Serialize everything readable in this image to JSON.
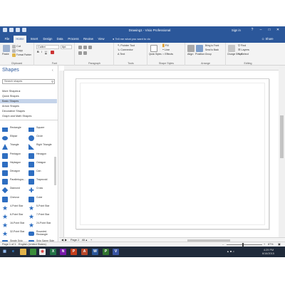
{
  "window": {
    "title": "Drawing1 - Visio Professional",
    "sign_in": "Sign in",
    "controls": [
      "?",
      "–",
      "□",
      "✕"
    ]
  },
  "tabs": [
    {
      "label": "File"
    },
    {
      "label": "Home",
      "active": true
    },
    {
      "label": "Insert"
    },
    {
      "label": "Design"
    },
    {
      "label": "Data"
    },
    {
      "label": "Process"
    },
    {
      "label": "Review"
    },
    {
      "label": "View"
    }
  ],
  "tell_me": "Tell me what you want to do",
  "share": "Share",
  "ribbon": {
    "clipboard": {
      "label": "Clipboard",
      "paste": "Paste",
      "cut": "Cut",
      "copy": "Copy",
      "format_painter": "Format Painter"
    },
    "font": {
      "label": "Font",
      "name": "Calibri",
      "size": "8pt."
    },
    "paragraph": {
      "label": "Paragraph"
    },
    "tools": {
      "label": "Tools",
      "pointer": "Pointer Tool",
      "connector": "Connector",
      "text": "Text"
    },
    "shape_styles": {
      "label": "Shape Styles",
      "fill": "Fill",
      "line": "Line",
      "effects": "Effects",
      "quick_styles": "Quick Styles"
    },
    "arrange": {
      "label": "Arrange",
      "align": "Align",
      "position": "Position",
      "bring_front": "Bring to Front",
      "send_back": "Send to Back",
      "group": "Group"
    },
    "editing": {
      "label": "Editing",
      "change_shape": "Change Shape",
      "find": "Find",
      "layers": "Layers",
      "select": "Select"
    }
  },
  "pane": {
    "title": "Shapes",
    "search_placeholder": "Search shapes",
    "stencils": [
      "More Shapes",
      "Quick Shapes",
      "Basic Shapes",
      "Arrow Shapes",
      "Decorative Shapes",
      "Graph and Math Shapes"
    ],
    "selected_stencil": "Basic Shapes",
    "shapes": [
      [
        "Rectangle",
        "Square"
      ],
      [
        "Ellipse",
        "Circle"
      ],
      [
        "Triangle",
        "Right Triangle"
      ],
      [
        "Pentagon",
        "Hexagon"
      ],
      [
        "Heptagon",
        "Octagon"
      ],
      [
        "Decagon",
        "Can"
      ],
      [
        "Parallelogra...",
        "Trapezoid"
      ],
      [
        "Diamond",
        "Cross"
      ],
      [
        "Chevron",
        "Cube"
      ],
      [
        "4-Point Star",
        "5-Point Star"
      ],
      [
        "6-Point Star",
        "7-Point Star"
      ],
      [
        "16-Point Star",
        "24-Point Star"
      ],
      [
        "32-Point Star",
        "Rounded Rectangle"
      ],
      [
        "Single Snip Corner",
        "Snip Same Side"
      ]
    ]
  },
  "page_tabs": {
    "page": "Page-1",
    "all": "All ▴",
    "add": "+"
  },
  "status": {
    "page": "Page 1 of 1",
    "language": "English (United States)",
    "zoom": "87%"
  },
  "taskbar": {
    "time": "4:29 PM",
    "date": "6/16/2015"
  },
  "colors": {
    "accent": "#2b579a",
    "shape_fill": "#2e6ec1",
    "taskbar": "#1f2a3a"
  }
}
